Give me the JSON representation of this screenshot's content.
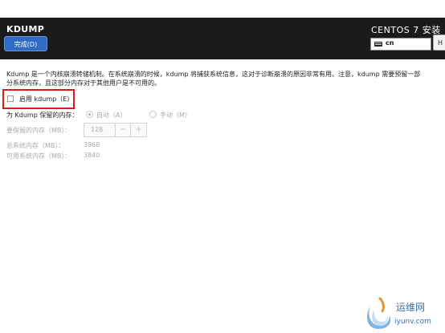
{
  "header": {
    "title": "KDUMP",
    "done_button": "完成(D)",
    "installer_title": "CENTOS 7 安装",
    "keyboard_layout": "cn",
    "help_button": "H"
  },
  "main": {
    "description_line1": "Kdump 是一个内核崩溃转储机制。在系统崩溃的时候，kdump 将捕获系统信息，这对于诊断崩溃的原因非常有用。注意，kdump 需要预留一部",
    "description_line2": "分系统内存，且这部分内存对于其他用户是不可用的。",
    "enable_checkbox": {
      "label": "启用 kdump（E）",
      "checked": false
    },
    "reserve_memory": {
      "label": "为 Kdump 保留的内存：",
      "options": [
        {
          "label": "自动（A）",
          "selected": true
        },
        {
          "label": "手动（M）",
          "selected": false
        }
      ]
    },
    "memory_to_reserve": {
      "label": "要保留的内存（MB）：",
      "value": "128",
      "decrement": "−",
      "increment": "+"
    },
    "total_memory": {
      "label": "总系统内存（MB）：",
      "value": "3968"
    },
    "usable_memory": {
      "label": "可用系统内存（MB）：",
      "value": "3840"
    }
  },
  "watermark": {
    "text": "运维网",
    "url": "iyunv.com"
  },
  "colors": {
    "header_bg": "#1b1b1b",
    "done_button": "#2f6cc6",
    "highlight": "#e01818",
    "watermark": "#3a6fb0"
  }
}
